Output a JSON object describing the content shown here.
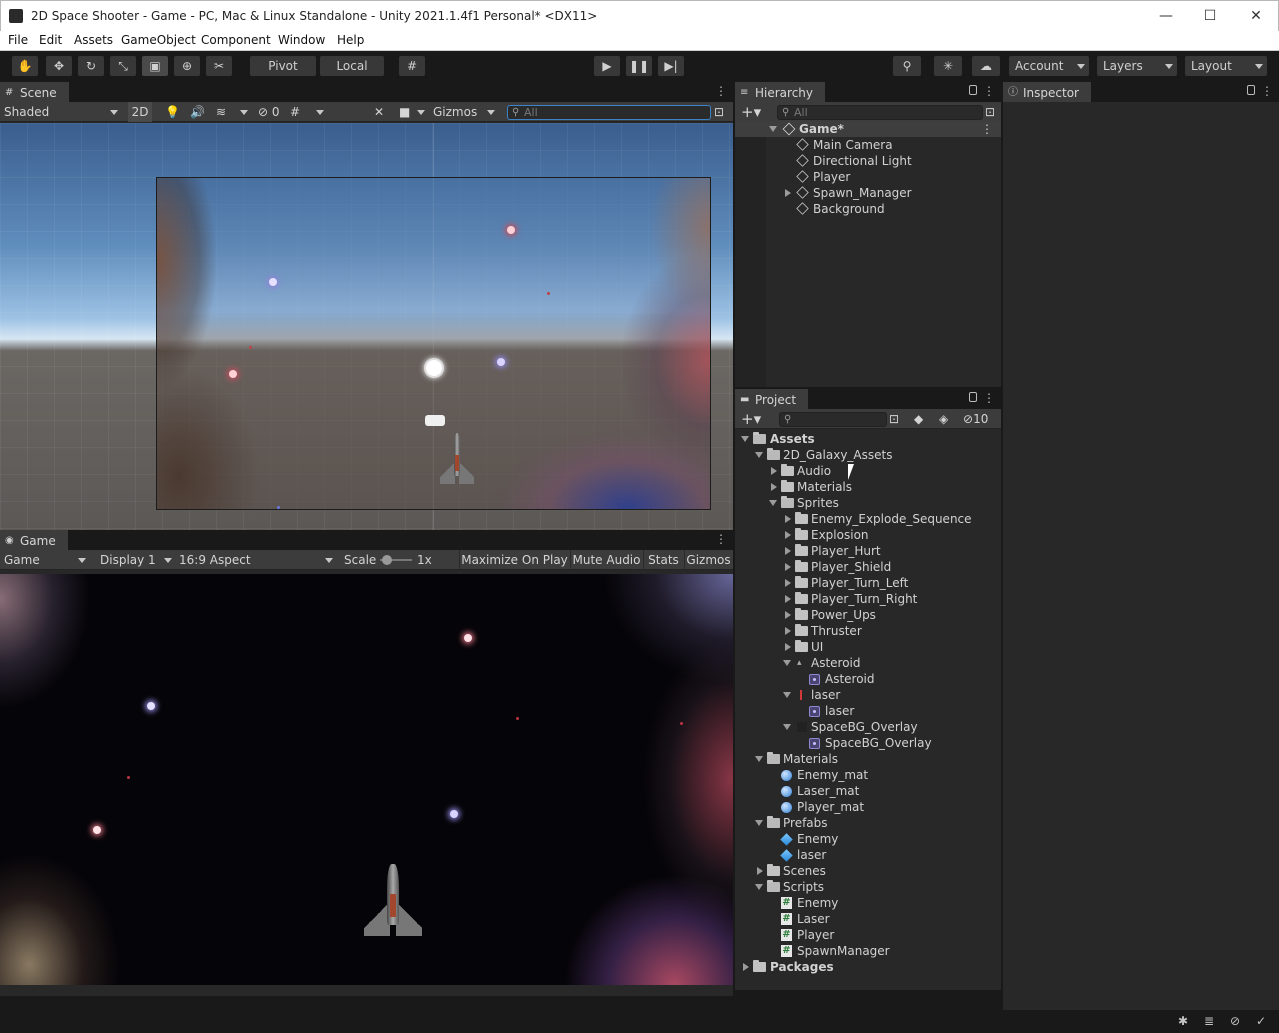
{
  "window": {
    "title": "2D Space Shooter - Game - PC, Mac & Linux Standalone - Unity 2021.1.4f1 Personal* <DX11>",
    "minimize": "—",
    "maximize": "☐",
    "close": "✕"
  },
  "menu": [
    "File",
    "Edit",
    "Assets",
    "GameObject",
    "Component",
    "Window",
    "Help"
  ],
  "toolbar": {
    "pivot": "Pivot",
    "local": "Local",
    "account": "Account",
    "layers": "Layers",
    "layout": "Layout"
  },
  "scene": {
    "tab": "Scene",
    "shading": "Shaded",
    "mode2d": "2D",
    "hidden_count": "0",
    "gizmos": "Gizmos",
    "search_placeholder": "All"
  },
  "game": {
    "tab": "Game",
    "view": "Game",
    "display": "Display 1",
    "aspect": "16:9 Aspect",
    "scale_label": "Scale",
    "scale_value": "1x",
    "maximize": "Maximize On Play",
    "mute": "Mute Audio",
    "stats": "Stats",
    "gizmos": "Gizmos"
  },
  "hierarchy": {
    "tab": "Hierarchy",
    "search_placeholder": "All",
    "scene_name": "Game*",
    "items": [
      "Main Camera",
      "Directional Light",
      "Player",
      "Spawn_Manager",
      "Background"
    ]
  },
  "inspector": {
    "tab": "Inspector"
  },
  "project": {
    "tab": "Project",
    "hidden_count": "10",
    "tree": {
      "assets": "Assets",
      "galaxy": "2D_Galaxy_Assets",
      "audio": "Audio",
      "materials_sub": "Materials",
      "sprites": "Sprites",
      "sprite_folders": [
        "Enemy_Explode_Sequence",
        "Explosion",
        "Player_Hurt",
        "Player_Shield",
        "Player_Turn_Left",
        "Player_Turn_Right",
        "Power_Ups",
        "Thruster",
        "UI"
      ],
      "asteroid": "Asteroid",
      "asteroid_sprite": "Asteroid",
      "laser": "laser",
      "laser_sprite": "laser",
      "spacebg": "SpaceBG_Overlay",
      "spacebg_sprite": "SpaceBG_Overlay",
      "materials": "Materials",
      "material_items": [
        "Enemy_mat",
        "Laser_mat",
        "Player_mat"
      ],
      "prefabs": "Prefabs",
      "prefab_items": [
        "Enemy",
        "laser"
      ],
      "scenes": "Scenes",
      "scripts": "Scripts",
      "script_items": [
        "Enemy",
        "Laser",
        "Player",
        "SpawnManager"
      ],
      "packages": "Packages"
    }
  },
  "colors": {
    "editor_bg": "#191919",
    "panel_bg": "#282828",
    "header_bg": "#3c3c3c",
    "sky_blue": "#9dc2e4",
    "material_blue": "#2f7fd5"
  }
}
